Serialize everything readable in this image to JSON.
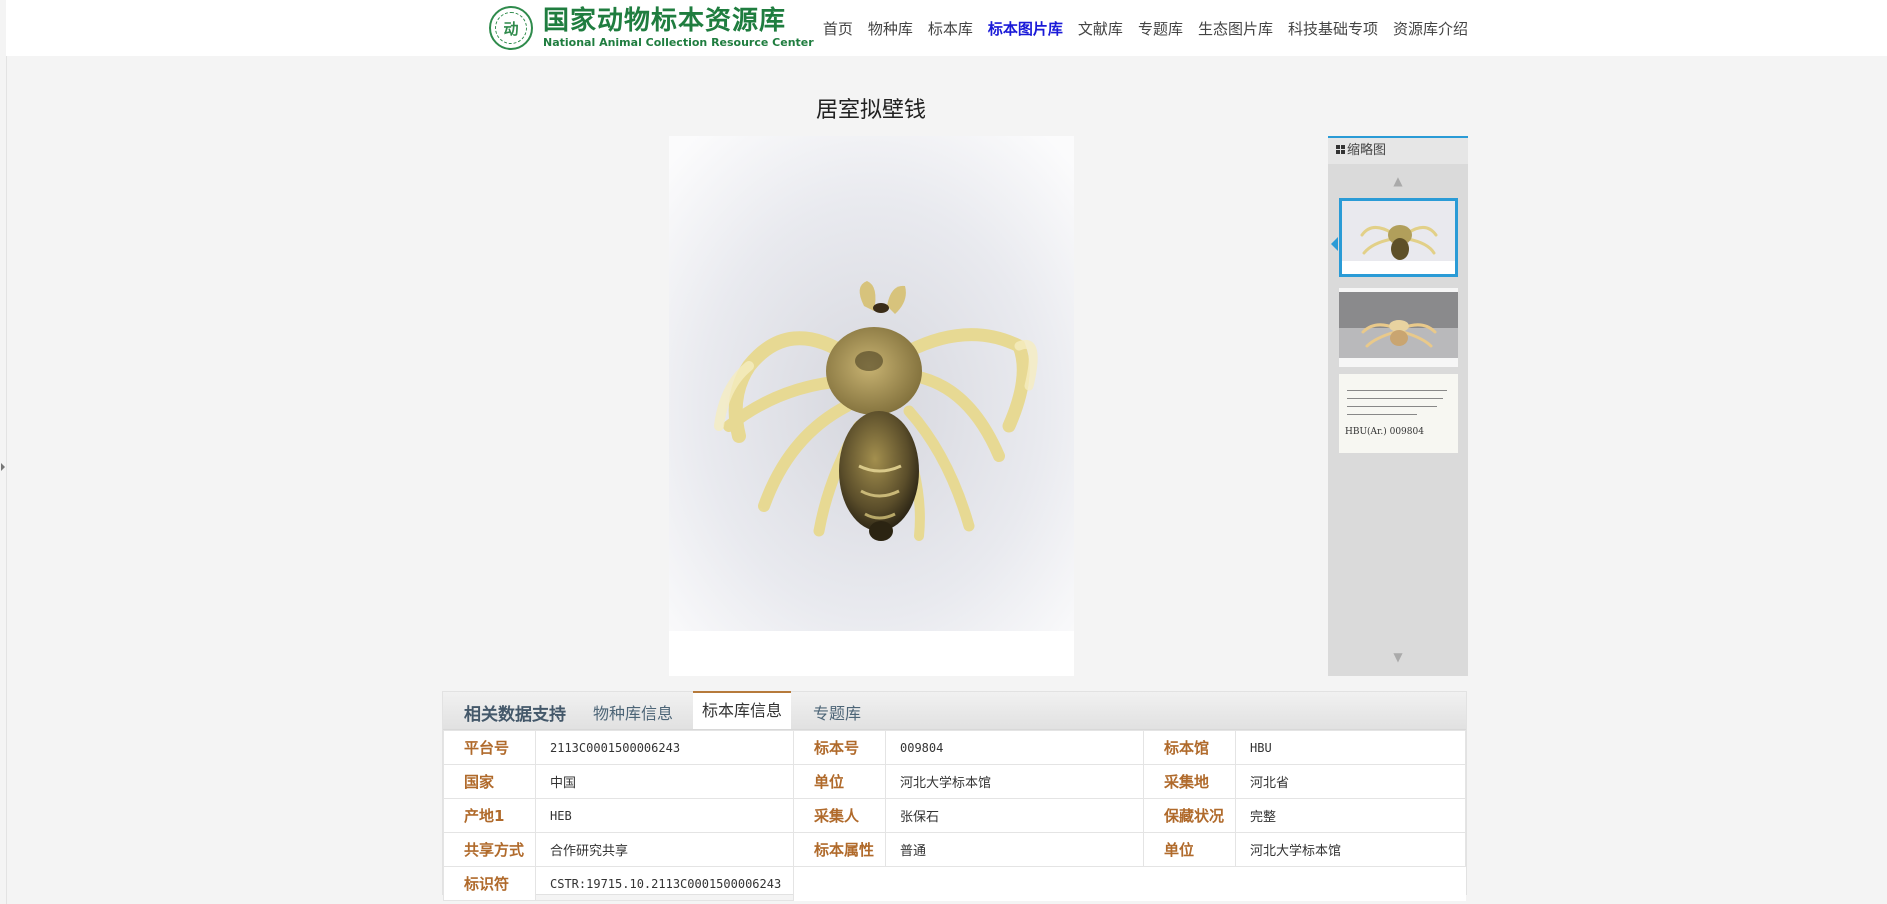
{
  "header": {
    "logo_cn": "国家动物标本资源库",
    "logo_en": "National Animal Collection Resource Center",
    "nav": [
      {
        "label": "首页"
      },
      {
        "label": "物种库"
      },
      {
        "label": "标本库"
      },
      {
        "label": "标本图片库",
        "active": true
      },
      {
        "label": "文献库"
      },
      {
        "label": "专题库"
      },
      {
        "label": "生态图片库"
      },
      {
        "label": "科技基础专项"
      },
      {
        "label": "资源库介绍"
      }
    ]
  },
  "page_title": "居室拟壁钱",
  "thumbnails": {
    "title": "缩略图",
    "label_code": "HBU(Ar.) 009804",
    "items": [
      {
        "kind": "specimen-top-view",
        "selected": true
      },
      {
        "kind": "specimen-side-view",
        "selected": false
      },
      {
        "kind": "specimen-label",
        "selected": false
      }
    ]
  },
  "info": {
    "tabs_heading": "相关数据支持",
    "tabs": [
      {
        "label": "物种库信息",
        "active": false
      },
      {
        "label": "标本库信息",
        "active": true
      },
      {
        "label": "专题库",
        "active": false
      }
    ],
    "rows": [
      [
        {
          "k": "平台号",
          "v": "2113C0001500006243"
        },
        {
          "k": "标本号",
          "v": "009804"
        },
        {
          "k": "标本馆",
          "v": "HBU"
        }
      ],
      [
        {
          "k": "国家",
          "v": "中国"
        },
        {
          "k": "单位",
          "v": "河北大学标本馆"
        },
        {
          "k": "采集地",
          "v": "河北省"
        }
      ],
      [
        {
          "k": "产地1",
          "v": "HEB"
        },
        {
          "k": "采集人",
          "v": "张保石"
        },
        {
          "k": "保藏状况",
          "v": "完整"
        }
      ],
      [
        {
          "k": "共享方式",
          "v": "合作研究共享"
        },
        {
          "k": "标本属性",
          "v": "普通"
        },
        {
          "k": "单位",
          "v": "河北大学标本馆"
        }
      ],
      [
        {
          "k": "标识符",
          "v": "CSTR:19715.10.2113C0001500006243"
        }
      ]
    ]
  },
  "colors": {
    "brand_green": "#1f7d3f",
    "nav_active": "#1a1ad8",
    "accent_blue": "#2a9bd6",
    "key_brown": "#b06a2b"
  }
}
